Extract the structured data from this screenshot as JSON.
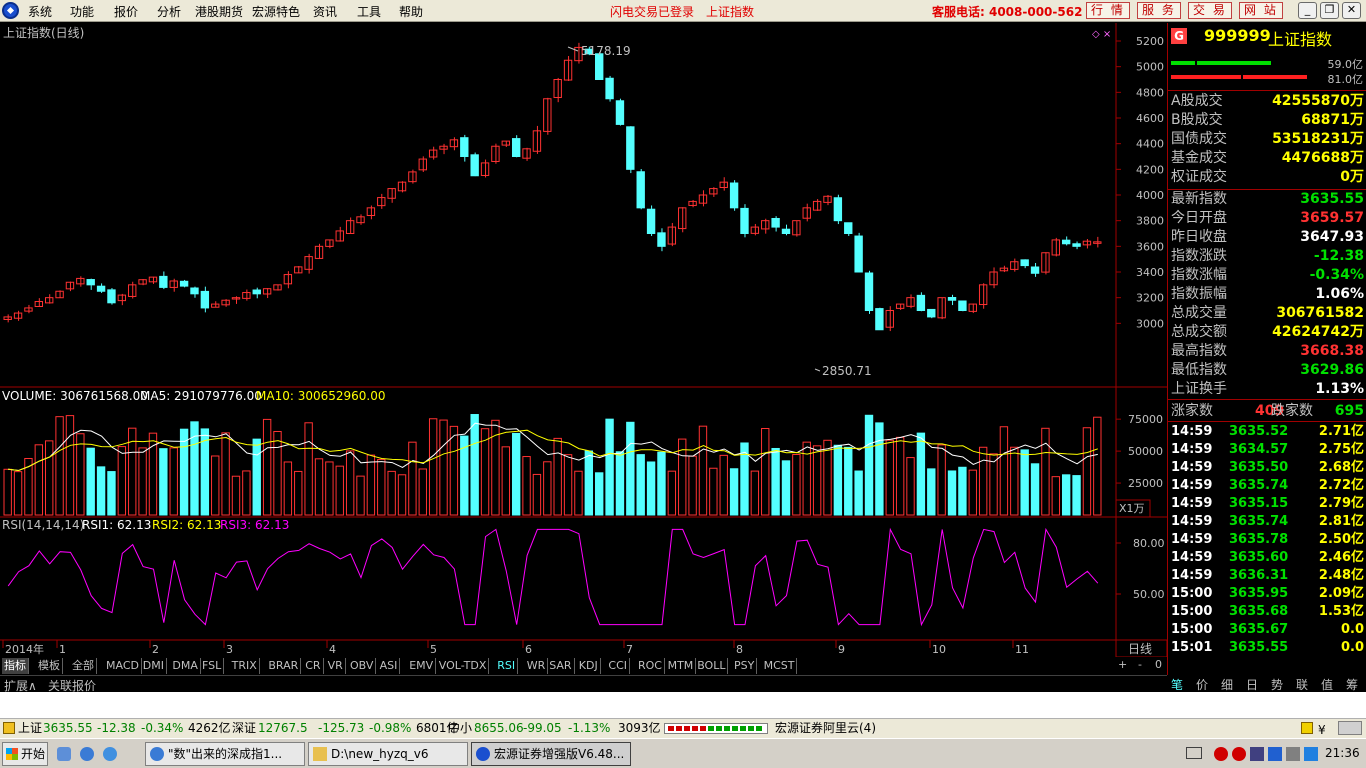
{
  "menu": {
    "items": [
      "系统",
      "功能",
      "报价",
      "分析",
      "港股期货",
      "宏源特色",
      "资讯",
      "工具",
      "帮助"
    ],
    "login_status": "闪电交易已登录",
    "current_index": "上证指数",
    "hotline": "客服电话: 4008-000-562",
    "buttons": [
      "行 情",
      "服 务",
      "交 易",
      "网 站"
    ]
  },
  "chart": {
    "main_title": "上证指数(日线)",
    "high_label": "5178.19",
    "low_label": "2850.71",
    "price_ticks": [
      "5200",
      "5000",
      "4800",
      "4600",
      "4400",
      "4200",
      "4000",
      "3800",
      "3600",
      "3400",
      "3200",
      "3000"
    ],
    "volume_header": {
      "label": "VOLUME: 306761568.00",
      "ma5": "MA5: 291079776.00",
      "ma10": "MA10: 300652960.00"
    },
    "volume_ticks": [
      "75000",
      "50000",
      "25000"
    ],
    "volume_unit": "X1万",
    "rsi_header": {
      "label": "RSI(14,14,14)",
      "rsi1": "RSI1: 62.13",
      "rsi2": "RSI2: 62.13",
      "rsi3": "RSI3: 62.13"
    },
    "rsi_ticks": [
      "80.00",
      "50.00"
    ],
    "x_labels": [
      "2014年",
      "1",
      "2",
      "3",
      "4",
      "5",
      "6",
      "7",
      "8",
      "9",
      "10",
      "11"
    ],
    "period_label": "日线",
    "colors": {
      "up": "#ff3232",
      "down": "#54ffff",
      "ma5": "#ffffff",
      "ma10": "#ffff00",
      "rsi": "#ff00ff",
      "axis": "#a00000"
    }
  },
  "chart_data": {
    "type": "candlestick",
    "title": "上证指数(日线)",
    "ylim": [
      2850,
      5250
    ],
    "high": 5178.19,
    "low": 2850.71,
    "close_approx": [
      3050,
      3080,
      3120,
      3170,
      3200,
      3250,
      3320,
      3350,
      3300,
      3250,
      3160,
      3220,
      3300,
      3340,
      3360,
      3280,
      3330,
      3290,
      3230,
      3120,
      3150,
      3180,
      3200,
      3240,
      3230,
      3270,
      3300,
      3380,
      3440,
      3520,
      3600,
      3650,
      3720,
      3800,
      3830,
      3900,
      3980,
      4050,
      4100,
      4180,
      4280,
      4350,
      4380,
      4430,
      4300,
      4150,
      4250,
      4380,
      4420,
      4300,
      4360,
      4500,
      4750,
      4900,
      5050,
      5150,
      5100,
      4900,
      4750,
      4550,
      4200,
      3900,
      3700,
      3600,
      3750,
      3900,
      3950,
      4000,
      4050,
      4100,
      3900,
      3700,
      3750,
      3800,
      3750,
      3700,
      3800,
      3900,
      3950,
      3990,
      3800,
      3700,
      3400,
      3100,
      2950,
      3100,
      3150,
      3200,
      3100,
      3050,
      3200,
      3180,
      3100,
      3150,
      3300,
      3400,
      3430,
      3480,
      3450,
      3390,
      3550,
      3650,
      3620,
      3600,
      3640,
      3635
    ],
    "volume_ticks": [
      75000,
      50000,
      25000
    ],
    "rsi_ticks": [
      80,
      50
    ],
    "rsi_last": 62.13
  },
  "tabs": [
    "指标",
    "模板",
    "全部",
    "MACD",
    "DMI",
    "DMA",
    "FSL",
    "TRIX",
    "BRAR",
    "CR",
    "VR",
    "OBV",
    "ASI",
    "EMV",
    "VOL-TDX",
    "RSI",
    "WR",
    "SAR",
    "KDJ",
    "CCI",
    "ROC",
    "MTM",
    "BOLL",
    "PSY",
    "MCST"
  ],
  "active_tab": "RSI",
  "tab_controls": [
    "+",
    "-",
    "0"
  ],
  "ext": {
    "expand": "扩展∧",
    "link": "关联报价"
  },
  "panel": {
    "badge": "G",
    "code": "999999",
    "name": "上证指数",
    "bar_top": "59.0亿",
    "bar_bottom": "81.0亿",
    "rows_yellow": [
      {
        "label": "A股成交",
        "value": "42555870万"
      },
      {
        "label": "B股成交",
        "value": "68871万"
      },
      {
        "label": "国债成交",
        "value": "53518231万"
      },
      {
        "label": "基金成交",
        "value": "4476688万"
      },
      {
        "label": "权证成交",
        "value": "0万"
      }
    ],
    "rows_main": [
      {
        "label": "最新指数",
        "value": "3635.55",
        "color": "#00e000"
      },
      {
        "label": "今日开盘",
        "value": "3659.57",
        "color": "#ff3232"
      },
      {
        "label": "昨日收盘",
        "value": "3647.93",
        "color": "#ffffff"
      },
      {
        "label": "指数涨跌",
        "value": "-12.38",
        "color": "#00e000"
      },
      {
        "label": "指数涨幅",
        "value": "-0.34%",
        "color": "#00e000"
      },
      {
        "label": "指数振幅",
        "value": "1.06%",
        "color": "#ffffff"
      },
      {
        "label": "总成交量",
        "value": "306761582",
        "color": "#ffff00"
      },
      {
        "label": "总成交额",
        "value": "42624742万",
        "color": "#ffff00"
      },
      {
        "label": "最高指数",
        "value": "3668.38",
        "color": "#ff3232"
      },
      {
        "label": "最低指数",
        "value": "3629.86",
        "color": "#00e000"
      },
      {
        "label": "上证换手",
        "value": "1.13%",
        "color": "#ffffff"
      }
    ],
    "up_label": "涨家数",
    "up_count": "409",
    "down_label": "跌家数",
    "down_count": "695",
    "ticks": [
      {
        "time": "14:59",
        "price": "3635.52",
        "vol": "2.71亿"
      },
      {
        "time": "14:59",
        "price": "3634.57",
        "vol": "2.75亿"
      },
      {
        "time": "14:59",
        "price": "3635.50",
        "vol": "2.68亿"
      },
      {
        "time": "14:59",
        "price": "3635.74",
        "vol": "2.72亿"
      },
      {
        "time": "14:59",
        "price": "3635.15",
        "vol": "2.79亿"
      },
      {
        "time": "14:59",
        "price": "3635.74",
        "vol": "2.81亿"
      },
      {
        "time": "14:59",
        "price": "3635.78",
        "vol": "2.50亿"
      },
      {
        "time": "14:59",
        "price": "3635.60",
        "vol": "2.46亿"
      },
      {
        "time": "14:59",
        "price": "3636.31",
        "vol": "2.48亿"
      },
      {
        "time": "15:00",
        "price": "3635.95",
        "vol": "2.09亿"
      },
      {
        "time": "15:00",
        "price": "3635.68",
        "vol": "1.53亿"
      },
      {
        "time": "15:00",
        "price": "3635.67",
        "vol": "0.0"
      },
      {
        "time": "15:01",
        "price": "3635.55",
        "vol": "0.0"
      }
    ],
    "bottom_tabs": [
      "笔",
      "价",
      "细",
      "日",
      "势",
      "联",
      "值",
      "筹"
    ]
  },
  "status": {
    "sh_label": "上证",
    "sh_price": "3635.55",
    "sh_change": "-12.38",
    "sh_pct": "-0.34%",
    "sh_amount": "4262亿",
    "sz_label": "深证",
    "sz_price": "12767.5",
    "sz_change": "-125.73",
    "sz_pct": "-0.98%",
    "sz_amount": "6801亿",
    "zx_label": "中小",
    "zx_price": "8655.06",
    "zx_change": "-99.05",
    "zx_pct": "-1.13%",
    "zx_amount": "3093亿",
    "server": "宏源证券阿里云(4)"
  },
  "taskbar": {
    "start": "开始",
    "tasks": [
      "\"数\"出来的深成指1...",
      "D:\\new_hyzq_v6",
      "宏源证券增强版V6.48..."
    ],
    "clock": "21:36"
  }
}
